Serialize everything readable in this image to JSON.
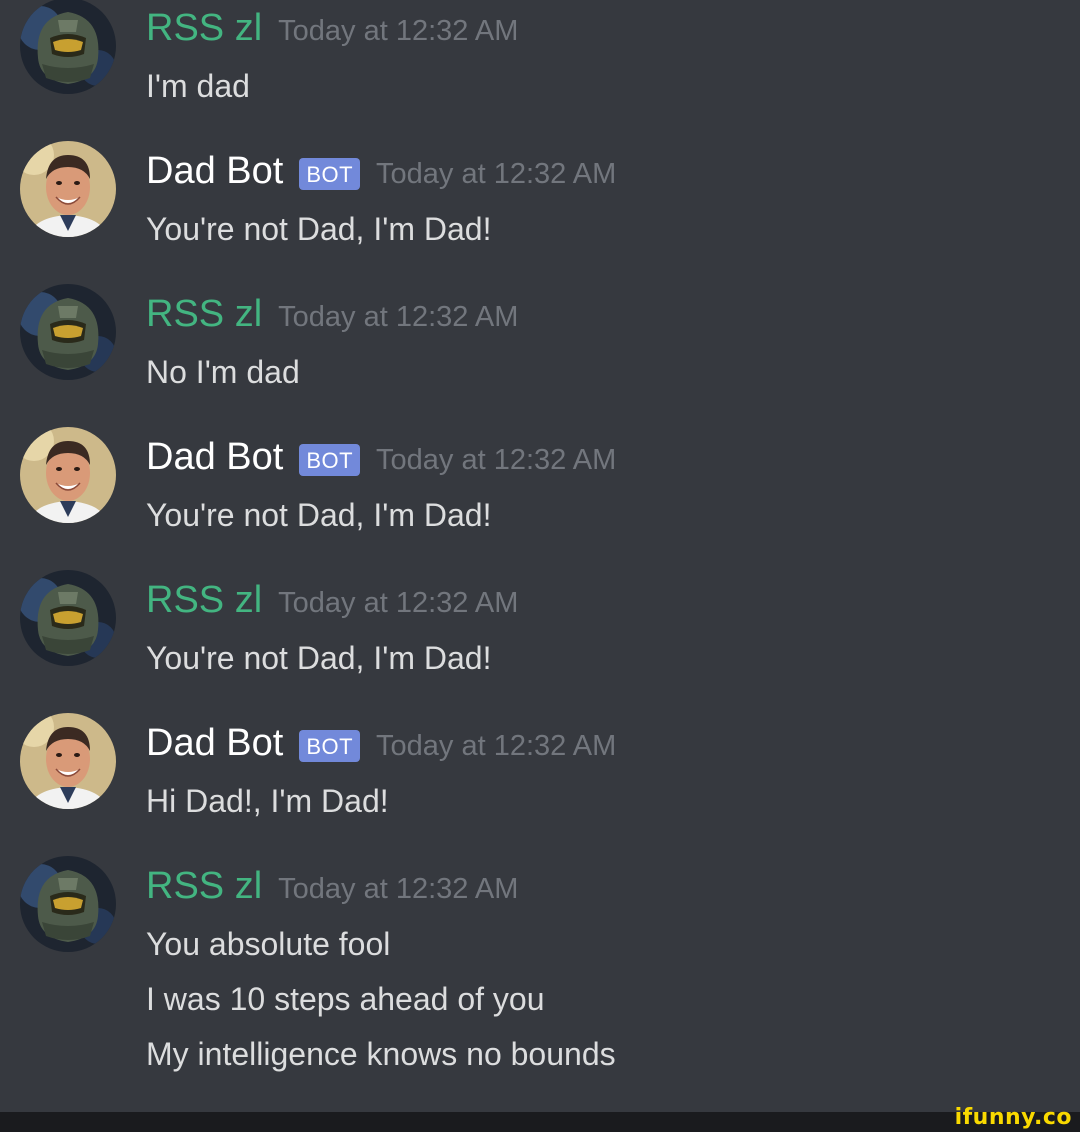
{
  "colors": {
    "background": "#36393f",
    "user_name": "#43b581",
    "bot_name": "#ffffff",
    "bot_tag": "#7289da",
    "timestamp": "#72767d",
    "message_text": "#dcddde",
    "watermark": "#f9d900"
  },
  "messages": [
    {
      "author": "RSS zl",
      "avatar_icon": "spartan-helmet-avatar",
      "bot": false,
      "timestamp": "Today at 12:32 AM",
      "lines": [
        "I'm dad"
      ]
    },
    {
      "author": "Dad Bot",
      "avatar_icon": "smiling-man-avatar",
      "bot": true,
      "tag": "BOT",
      "timestamp": "Today at 12:32 AM",
      "lines": [
        "You're not Dad, I'm Dad!"
      ]
    },
    {
      "author": "RSS zl",
      "avatar_icon": "spartan-helmet-avatar",
      "bot": false,
      "timestamp": "Today at 12:32 AM",
      "lines": [
        "No I'm dad"
      ]
    },
    {
      "author": "Dad Bot",
      "avatar_icon": "smiling-man-avatar",
      "bot": true,
      "tag": "BOT",
      "timestamp": "Today at 12:32 AM",
      "lines": [
        "You're not Dad, I'm Dad!"
      ]
    },
    {
      "author": "RSS zl",
      "avatar_icon": "spartan-helmet-avatar",
      "bot": false,
      "timestamp": "Today at 12:32 AM",
      "lines": [
        "You're not Dad, I'm Dad!"
      ]
    },
    {
      "author": "Dad Bot",
      "avatar_icon": "smiling-man-avatar",
      "bot": true,
      "tag": "BOT",
      "timestamp": "Today at 12:32 AM",
      "lines": [
        "Hi Dad!, I'm Dad!"
      ]
    },
    {
      "author": "RSS zl",
      "avatar_icon": "spartan-helmet-avatar",
      "bot": false,
      "timestamp": "Today at 12:32 AM",
      "lines": [
        "You absolute fool",
        "I was 10 steps ahead of you",
        "My intelligence knows no bounds"
      ]
    }
  ],
  "watermark": "ifunny.co"
}
